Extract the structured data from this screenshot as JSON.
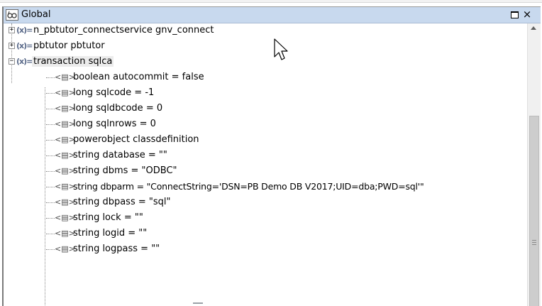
{
  "window": {
    "title": "Global",
    "title_icon": "watch-glasses-icon",
    "restore_icon": "restore-icon",
    "close_icon": "close-icon",
    "close_glyph": "×"
  },
  "tree": {
    "roots": [
      {
        "expander": "+",
        "var_icon": "(x)=",
        "label": "n_pbtutor_connectservice gnv_connect",
        "expanded": false
      },
      {
        "expander": "+",
        "var_icon": "(x)=",
        "label": "pbtutor pbtutor",
        "expanded": false
      },
      {
        "expander": "−",
        "var_icon": "(x)=",
        "label": "transaction sqlca",
        "expanded": true,
        "selected": true
      }
    ],
    "children": [
      {
        "icon": "<▤>",
        "label": "boolean autocommit = false"
      },
      {
        "icon": "<▤>",
        "label": "long sqlcode = -1"
      },
      {
        "icon": "<▤>",
        "label": "long sqldbcode = 0"
      },
      {
        "icon": "<▤>",
        "label": "long sqlnrows = 0"
      },
      {
        "icon": "<▤>",
        "label": "powerobject classdefinition"
      },
      {
        "icon": "<▤>",
        "label": "string database = \"\""
      },
      {
        "icon": "<▤>",
        "label": "string dbms = \"ODBC\""
      },
      {
        "icon": "<▤>",
        "label": "string dbparm = \"ConnectString='DSN=PB Demo DB V2017;UID=dba;PWD=sql'\""
      },
      {
        "icon": "<▤>",
        "label": "string dbpass = \"sql\""
      },
      {
        "icon": "<▤>",
        "label": "string lock = \"\""
      },
      {
        "icon": "<▤>",
        "label": "string logid = \"\""
      },
      {
        "icon": "<▤>",
        "label": "string logpass = \"\""
      }
    ]
  },
  "scrollbar": {
    "up_icon": "scroll-up-arrow-icon",
    "position_fraction": 0.33
  },
  "cursor": {
    "icon": "mouse-pointer-icon"
  },
  "colors": {
    "titlebar": "#c8d9ee",
    "selection": "#ececec",
    "tree_lines": "#8a8a8a"
  }
}
